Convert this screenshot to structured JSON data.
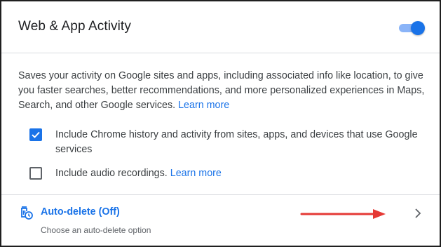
{
  "header": {
    "title": "Web & App Activity",
    "toggle_on": true
  },
  "description": {
    "text": "Saves your activity on Google sites and apps, including associated info like location, to give you faster searches, better recommendations, and more personalized experiences in Maps, Search, and other Google services.",
    "link": "Learn more"
  },
  "options": [
    {
      "label": "Include Chrome history and activity from sites, apps, and devices that use Google services",
      "checked": true
    },
    {
      "label": "Include audio recordings.",
      "link": "Learn more",
      "checked": false
    }
  ],
  "autodelete": {
    "title": "Auto-delete (Off)",
    "subtitle": "Choose an auto-delete option"
  },
  "colors": {
    "accent": "#1a73e8",
    "toggle_track": "#8ab4f8",
    "annotation_arrow": "#e53935",
    "text": "#3c4043"
  },
  "icons": {
    "checkbox_checked": "check-icon",
    "autodelete": "trash-clock-icon",
    "chevron": "chevron-right-icon",
    "annotation": "red-arrow-icon"
  }
}
